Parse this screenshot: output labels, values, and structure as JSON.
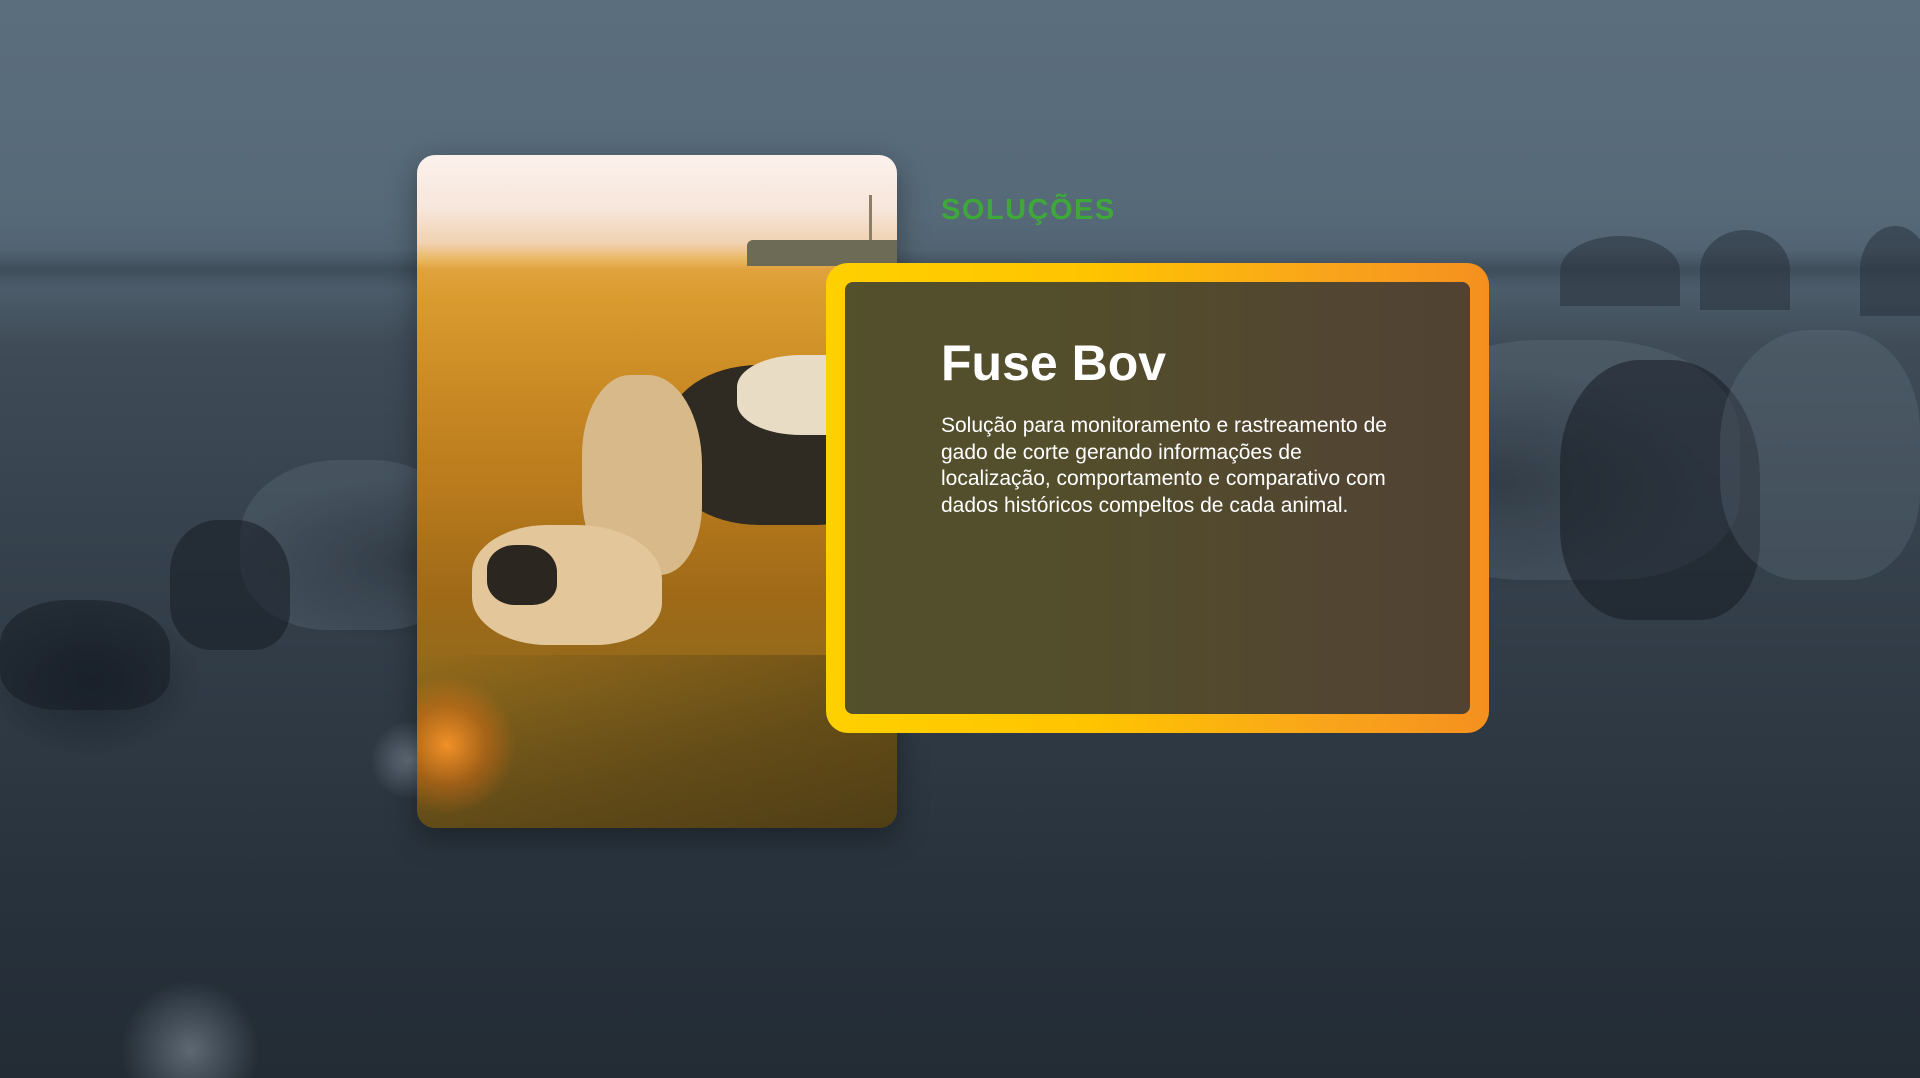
{
  "section": {
    "eyebrow": "SOLUÇÕES",
    "title": "Fuse Bov",
    "description": "Solução para monitoramento e rastreamento de gado de corte gerando informações de localização, comportamento e comparativo com dados históricos compeltos de cada animal."
  },
  "colors": {
    "eyebrow": "#3fa83a",
    "frame_gradient_start": "#ffd000",
    "frame_gradient_end": "#f5901f",
    "background_tint": "#2f3a45",
    "text": "#ffffff"
  },
  "images": {
    "background": "cattle-herd-blue-tinted-photo",
    "card": "cattle-at-sunset-photo"
  }
}
